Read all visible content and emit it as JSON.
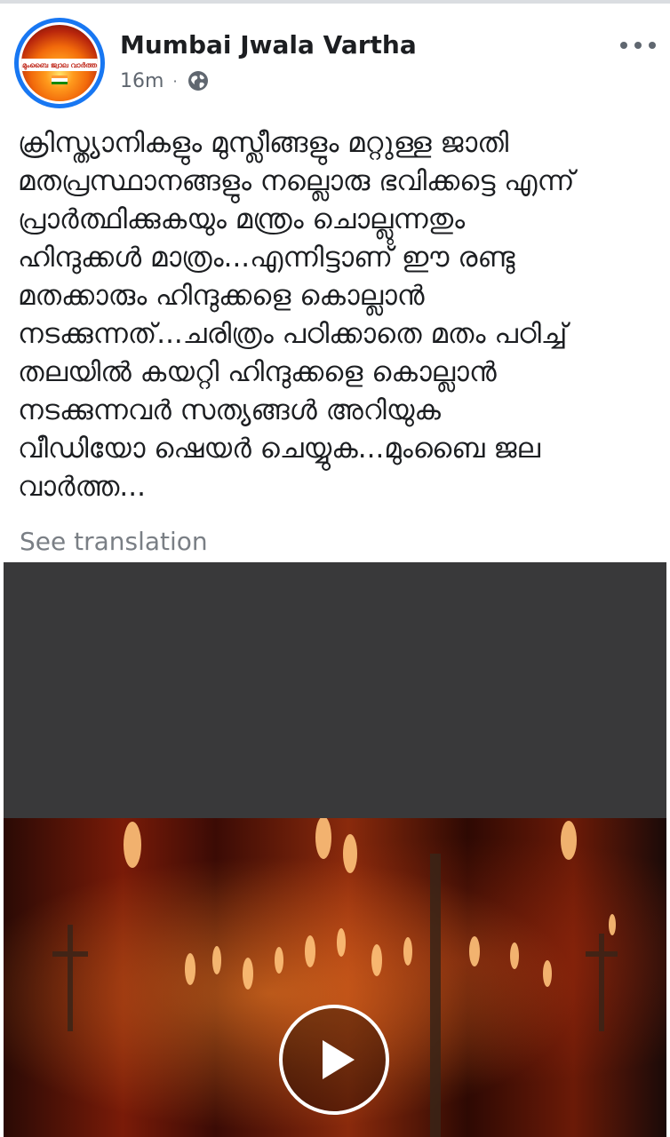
{
  "post": {
    "page_name": "Mumbai Jwala Vartha",
    "time": "16m",
    "separator": "·",
    "audience_icon": "globe-icon",
    "more_icon": "more-options-icon",
    "text": "ക്രിസ്ത്യാനികളും മുസ്ലീങ്ങളും മറ്റുള്ള ജാതി\nമതപ്രസ്ഥാനങ്ങളും നല്ലൊരു ഭവിക്കട്ടെ എന്ന്\nപ്രാർത്ഥിക്കുകയും മന്ത്രം ചൊല്ലുന്നതും\nഹിന്ദുക്കൾ മാത്രം...എന്നിട്ടാണ് ഈ രണ്ടു\nമതക്കാരും ഹിന്ദുക്കളെ കൊല്ലാൻ\nനടക്കുന്നത്...ചരിത്രം പഠിക്കാതെ മതം പഠിച്ച്\nതലയിൽ കയറ്റി ഹിന്ദുക്കളെ കൊല്ലാൻ\nനടക്കുന്നവർ സത്യങ്ങൾ അറിയുക\nവീഡിയോ ഷെയർ ചെയ്യുക...മുംബൈ ജല\nവാർത്ത...",
    "see_translation": "See translation"
  },
  "avatar": {
    "logo_text": "മുംബൈ ജ്വാല വാർത്ത",
    "ring_color": "#1877f2"
  },
  "video": {
    "play_icon": "play-icon",
    "accent_color": "#ff7a1c"
  }
}
